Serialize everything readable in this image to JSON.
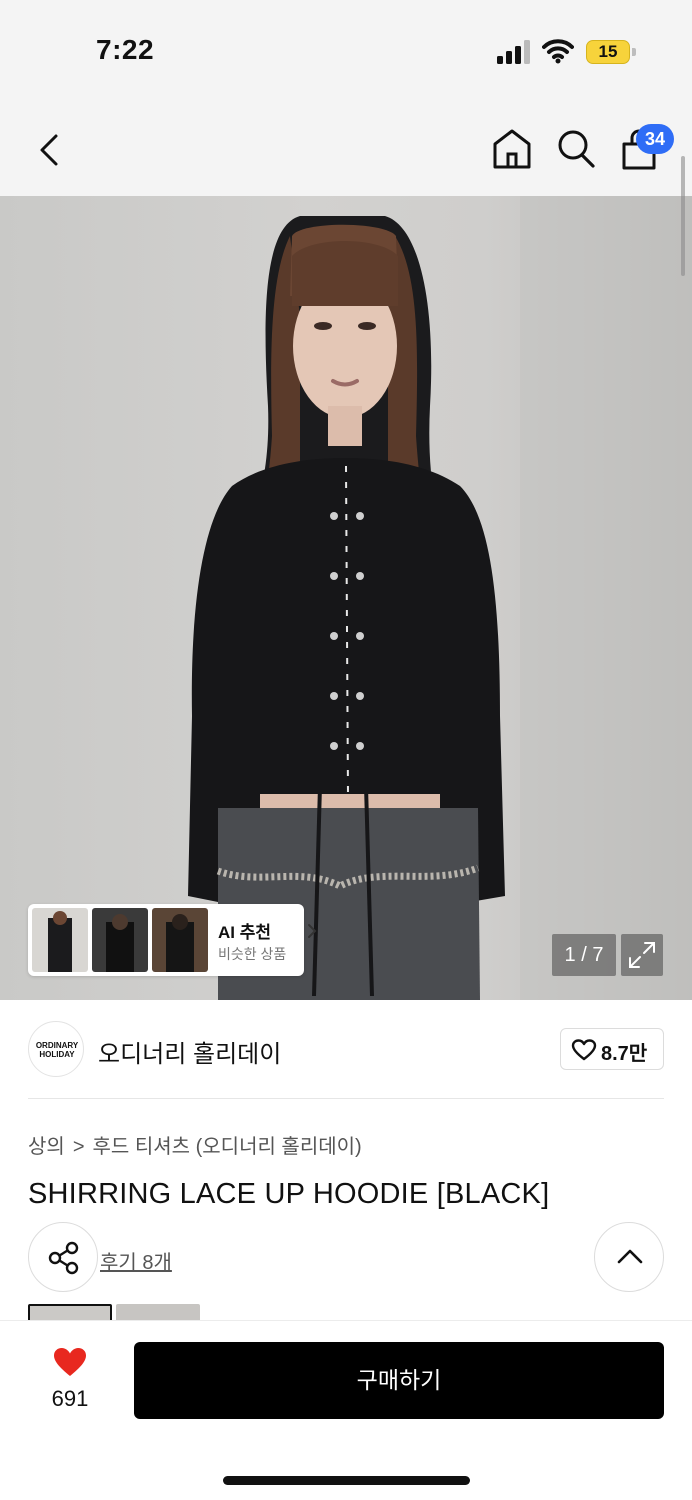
{
  "status": {
    "time": "7:22",
    "battery": "15",
    "battery_color": "#f7d33b"
  },
  "nav": {
    "back_icon": "chevron-left-icon",
    "home_icon": "home-icon",
    "search_icon": "search-icon",
    "bag_icon": "shopping-bag-icon",
    "cart_count": "34",
    "badge_color": "#2f6df6"
  },
  "gallery": {
    "image_index": "1 / 7",
    "expand_icon": "expand-icon",
    "ai": {
      "title": "AI 추천",
      "subtitle": "비슷한 상품"
    }
  },
  "brand": {
    "logo_line1": "ORDINARY",
    "logo_line2": "HOLIDAY",
    "name": "오디너리 홀리데이",
    "likes": "8.7만"
  },
  "product": {
    "breadcrumb": [
      "상의",
      "후드 티셔츠 (오디너리 홀리데이)"
    ],
    "title": "SHIRRING LACE UP HOODIE [BLACK]",
    "review_link": "후기 8개"
  },
  "bottom": {
    "wish_count": "691",
    "wish_color": "#e8281f",
    "buy_label": "구매하기"
  }
}
